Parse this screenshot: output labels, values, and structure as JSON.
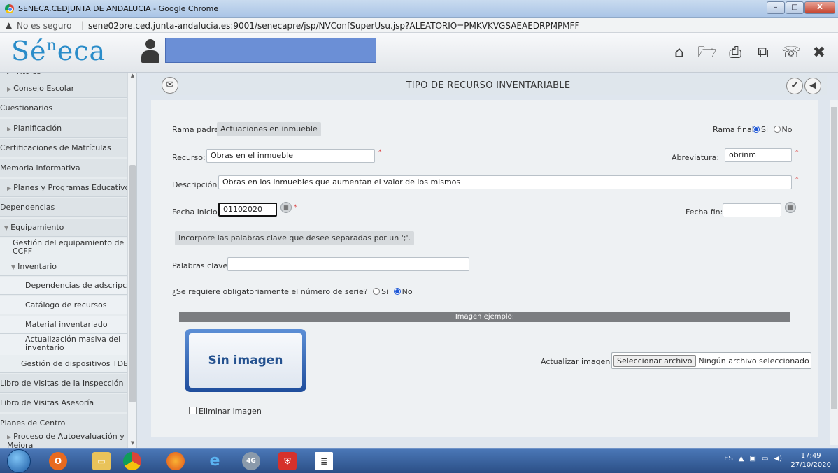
{
  "window": {
    "title": "SENECA.CEDJUNTA DE ANDALUCIA - Google Chrome",
    "min_label": "–",
    "max_label": "□",
    "close_label": "X"
  },
  "address": {
    "warning_icon": "▲",
    "secure_label": "No es seguro",
    "separator": "|",
    "url": "sene02pre.ced.junta-andalucia.es:9001/senecapre/jsp/NVConfSuperUsu.jsp?ALEATORIO=PMKVKVGSAEAEDRPMPMFF"
  },
  "header": {
    "logo_text": "Sé",
    "logo_sup": "n",
    "logo_rest": "eca",
    "icons": [
      "home-icon",
      "folder-open-icon",
      "print-icon",
      "copy-icon",
      "phone-icon",
      "close-icon"
    ],
    "icon_glyphs": [
      "⌂",
      "🗁",
      "⎙",
      "⧉",
      "☏",
      "✖"
    ]
  },
  "sidebar": {
    "top_fragment": "► Títulos",
    "items": [
      {
        "label": "Consejo Escolar",
        "arrow": "▶"
      },
      {
        "label": "Cuestionarios"
      },
      {
        "label": "Planificación",
        "arrow": "▶"
      },
      {
        "label": "Certificaciones de Matrículas"
      },
      {
        "label": "Memoria informativa"
      },
      {
        "label": "Planes y Programas Educativos",
        "arrow": "▶"
      },
      {
        "label": "Dependencias"
      },
      {
        "label": "Equipamiento",
        "arrow": "▼"
      },
      {
        "label": "Gestión del equipamiento de CCFF"
      },
      {
        "label": "Inventario",
        "arrow": "▼"
      },
      {
        "label": "Dependencias de adscripción"
      },
      {
        "label": "Catálogo de recursos"
      },
      {
        "label": "Material inventariado"
      },
      {
        "label": "Actualización masiva del inventario"
      },
      {
        "label": "Gestión de dispositivos TDE"
      },
      {
        "label": "Libro de Visitas de la Inspección"
      },
      {
        "label": "Libro de Visitas Asesoría"
      },
      {
        "label": "Planes de Centro"
      },
      {
        "label": "Proceso de Autoevaluación y Mejora",
        "arrow": "▶"
      }
    ]
  },
  "main": {
    "title": "TIPO DE RECURSO INVENTARIABLE",
    "rama_padre_label": "Rama padre:",
    "rama_padre_value": "Actuaciones en inmueble",
    "rama_final_label": "Rama final",
    "rama_final_options": [
      "Si",
      "No"
    ],
    "rama_final_selected": "Si",
    "recurso_label": "Recurso:",
    "recurso_value": "Obras en el inmueble",
    "abreviatura_label": "Abreviatura:",
    "abreviatura_value": "obrinm",
    "descripcion_label": "Descripción:",
    "descripcion_value": "Obras en los inmuebles que aumentan el valor de los mismos",
    "fecha_inicio_label": "Fecha inicio:",
    "fecha_inicio_value": "01102020",
    "fecha_fin_label": "Fecha fin:",
    "fecha_fin_value": "",
    "keywords_hint": "Incorpore las palabras clave que desee separadas por un ';'.",
    "palabras_label": "Palabras clave:",
    "palabras_value": "",
    "serie_question": "¿Se requiere obligatoriamente el número de serie?",
    "serie_options": [
      "Si",
      "No"
    ],
    "serie_selected": "No",
    "imagen_header": "Imagen ejemplo:",
    "sin_imagen": "Sin imagen",
    "actualizar_label": "Actualizar imagen:",
    "select_file_button": "Seleccionar archivo",
    "no_file_text": "Ningún archivo seleccionado",
    "eliminar_label": "Eliminar imagen",
    "required_mark": "*"
  },
  "taskbar": {
    "apps": [
      "windows-start",
      "outlook",
      "file-explorer",
      "chrome",
      "firefox",
      "internet-explorer",
      "4g-app",
      "antivirus",
      "document-app"
    ],
    "lang": "ES",
    "time": "17:49",
    "date": "27/10/2020"
  }
}
